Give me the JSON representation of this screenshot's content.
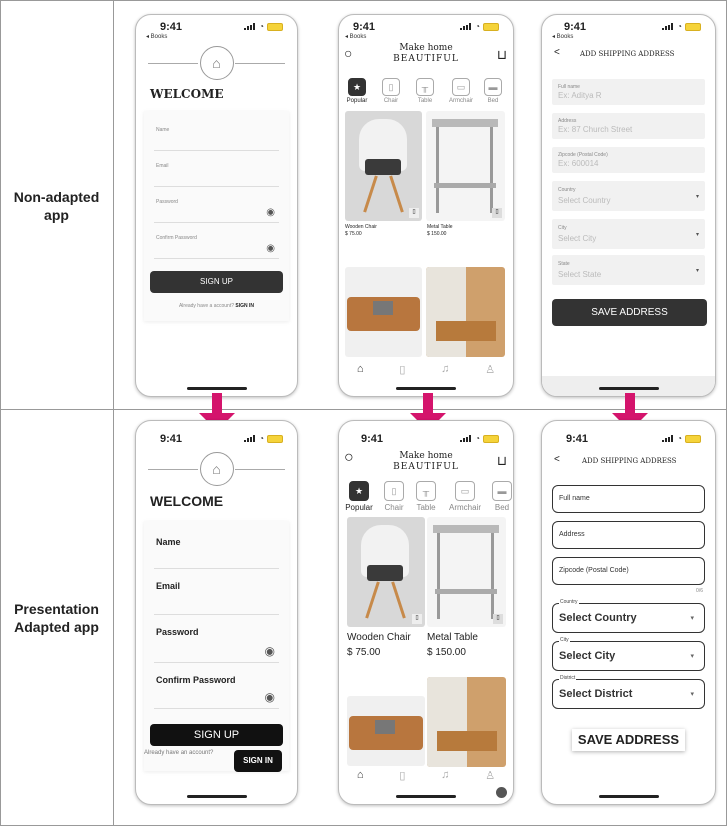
{
  "rows": {
    "top_label": "Non-adapted app",
    "bottom_label": "Presentation Adapted app"
  },
  "status": {
    "time": "9:41",
    "back_label": "◂ Books"
  },
  "signup_top": {
    "title": "WELCOME",
    "fields": [
      "Name",
      "Email",
      "Password",
      "Confirm Password"
    ],
    "button": "SIGN UP",
    "footer_text": "Already have a account?",
    "footer_link": "SIGN IN"
  },
  "signup_bottom": {
    "title": "WELCOME",
    "fields": [
      "Name",
      "Email",
      "Password",
      "Confirm Password"
    ],
    "button": "SIGN UP",
    "footer_text": "Already have an account?",
    "footer_link": "SIGN IN"
  },
  "shop": {
    "title_line1": "Make home",
    "title_line2": "BEAUTIFUL",
    "categories": [
      "Popular",
      "Chair",
      "Table",
      "Armchair",
      "Bed"
    ],
    "products": [
      {
        "name": "Wooden Chair",
        "price": "$ 75.00"
      },
      {
        "name": "Metal Table",
        "price": "$ 150.00"
      }
    ]
  },
  "address_top": {
    "header": "ADD SHIPPING ADDRESS",
    "fields": [
      {
        "label": "Full name",
        "value": "Ex: Aditya R"
      },
      {
        "label": "Address",
        "value": "Ex: 87 Church Street"
      },
      {
        "label": "Zipcode (Postal Code)",
        "value": "Ex: 600014"
      },
      {
        "label": "Country",
        "value": "Select Country"
      },
      {
        "label": "City",
        "value": "Select City"
      },
      {
        "label": "State",
        "value": "Select State"
      }
    ],
    "button": "SAVE ADDRESS"
  },
  "address_bottom": {
    "header": "ADD SHIPPING ADDRESS",
    "fields": [
      "Full name",
      "Address",
      "Zipcode (Postal Code)"
    ],
    "counter": "0/6",
    "selects": [
      {
        "label": "Country",
        "value": "Select Country"
      },
      {
        "label": "City",
        "value": "Select City"
      },
      {
        "label": "District",
        "value": "Select District"
      }
    ],
    "button": "SAVE ADDRESS"
  },
  "colors": {
    "arrow": "#d4146c",
    "battery": "#f5d33a",
    "dark_button": "#333333"
  },
  "icons": [
    "search-icon",
    "cart-icon",
    "star-icon",
    "chair-icon",
    "table-icon",
    "armchair-icon",
    "bed-icon",
    "home-icon",
    "bookmark-icon",
    "bell-icon",
    "user-icon",
    "eye-icon",
    "back-icon",
    "chevron-down-icon",
    "bookmark-badge-icon"
  ]
}
